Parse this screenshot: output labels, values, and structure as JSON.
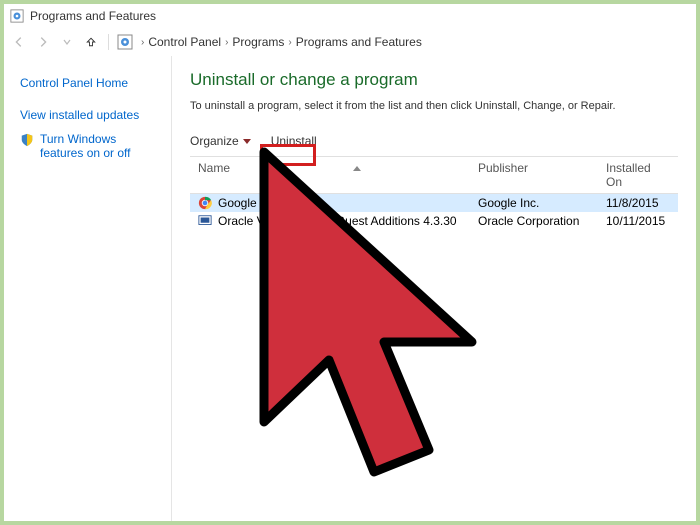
{
  "titlebar": {
    "title": "Programs and Features"
  },
  "breadcrumb": {
    "segments": [
      "Control Panel",
      "Programs",
      "Programs and Features"
    ]
  },
  "sidebar": {
    "home": "Control Panel Home",
    "items": [
      {
        "label": "View installed updates",
        "icon": null
      },
      {
        "label": "Turn Windows features on or off",
        "icon": "shield"
      }
    ]
  },
  "main": {
    "title": "Uninstall or change a program",
    "instruction": "To uninstall a program, select it from the list and then click Uninstall, Change, or Repair."
  },
  "toolbar": {
    "organize_label": "Organize",
    "uninstall_label": "Uninstall"
  },
  "table": {
    "columns": {
      "name": "Name",
      "publisher": "Publisher",
      "installed_on": "Installed On"
    },
    "rows": [
      {
        "name": "Google Chrome",
        "publisher": "Google Inc.",
        "installed_on": "11/8/2015",
        "icon": "chrome",
        "selected": true
      },
      {
        "name": "Oracle VM VirtualBox Guest Additions 4.3.30",
        "publisher": "Oracle Corporation",
        "installed_on": "10/11/2015",
        "icon": "vbox",
        "selected": false
      }
    ]
  }
}
